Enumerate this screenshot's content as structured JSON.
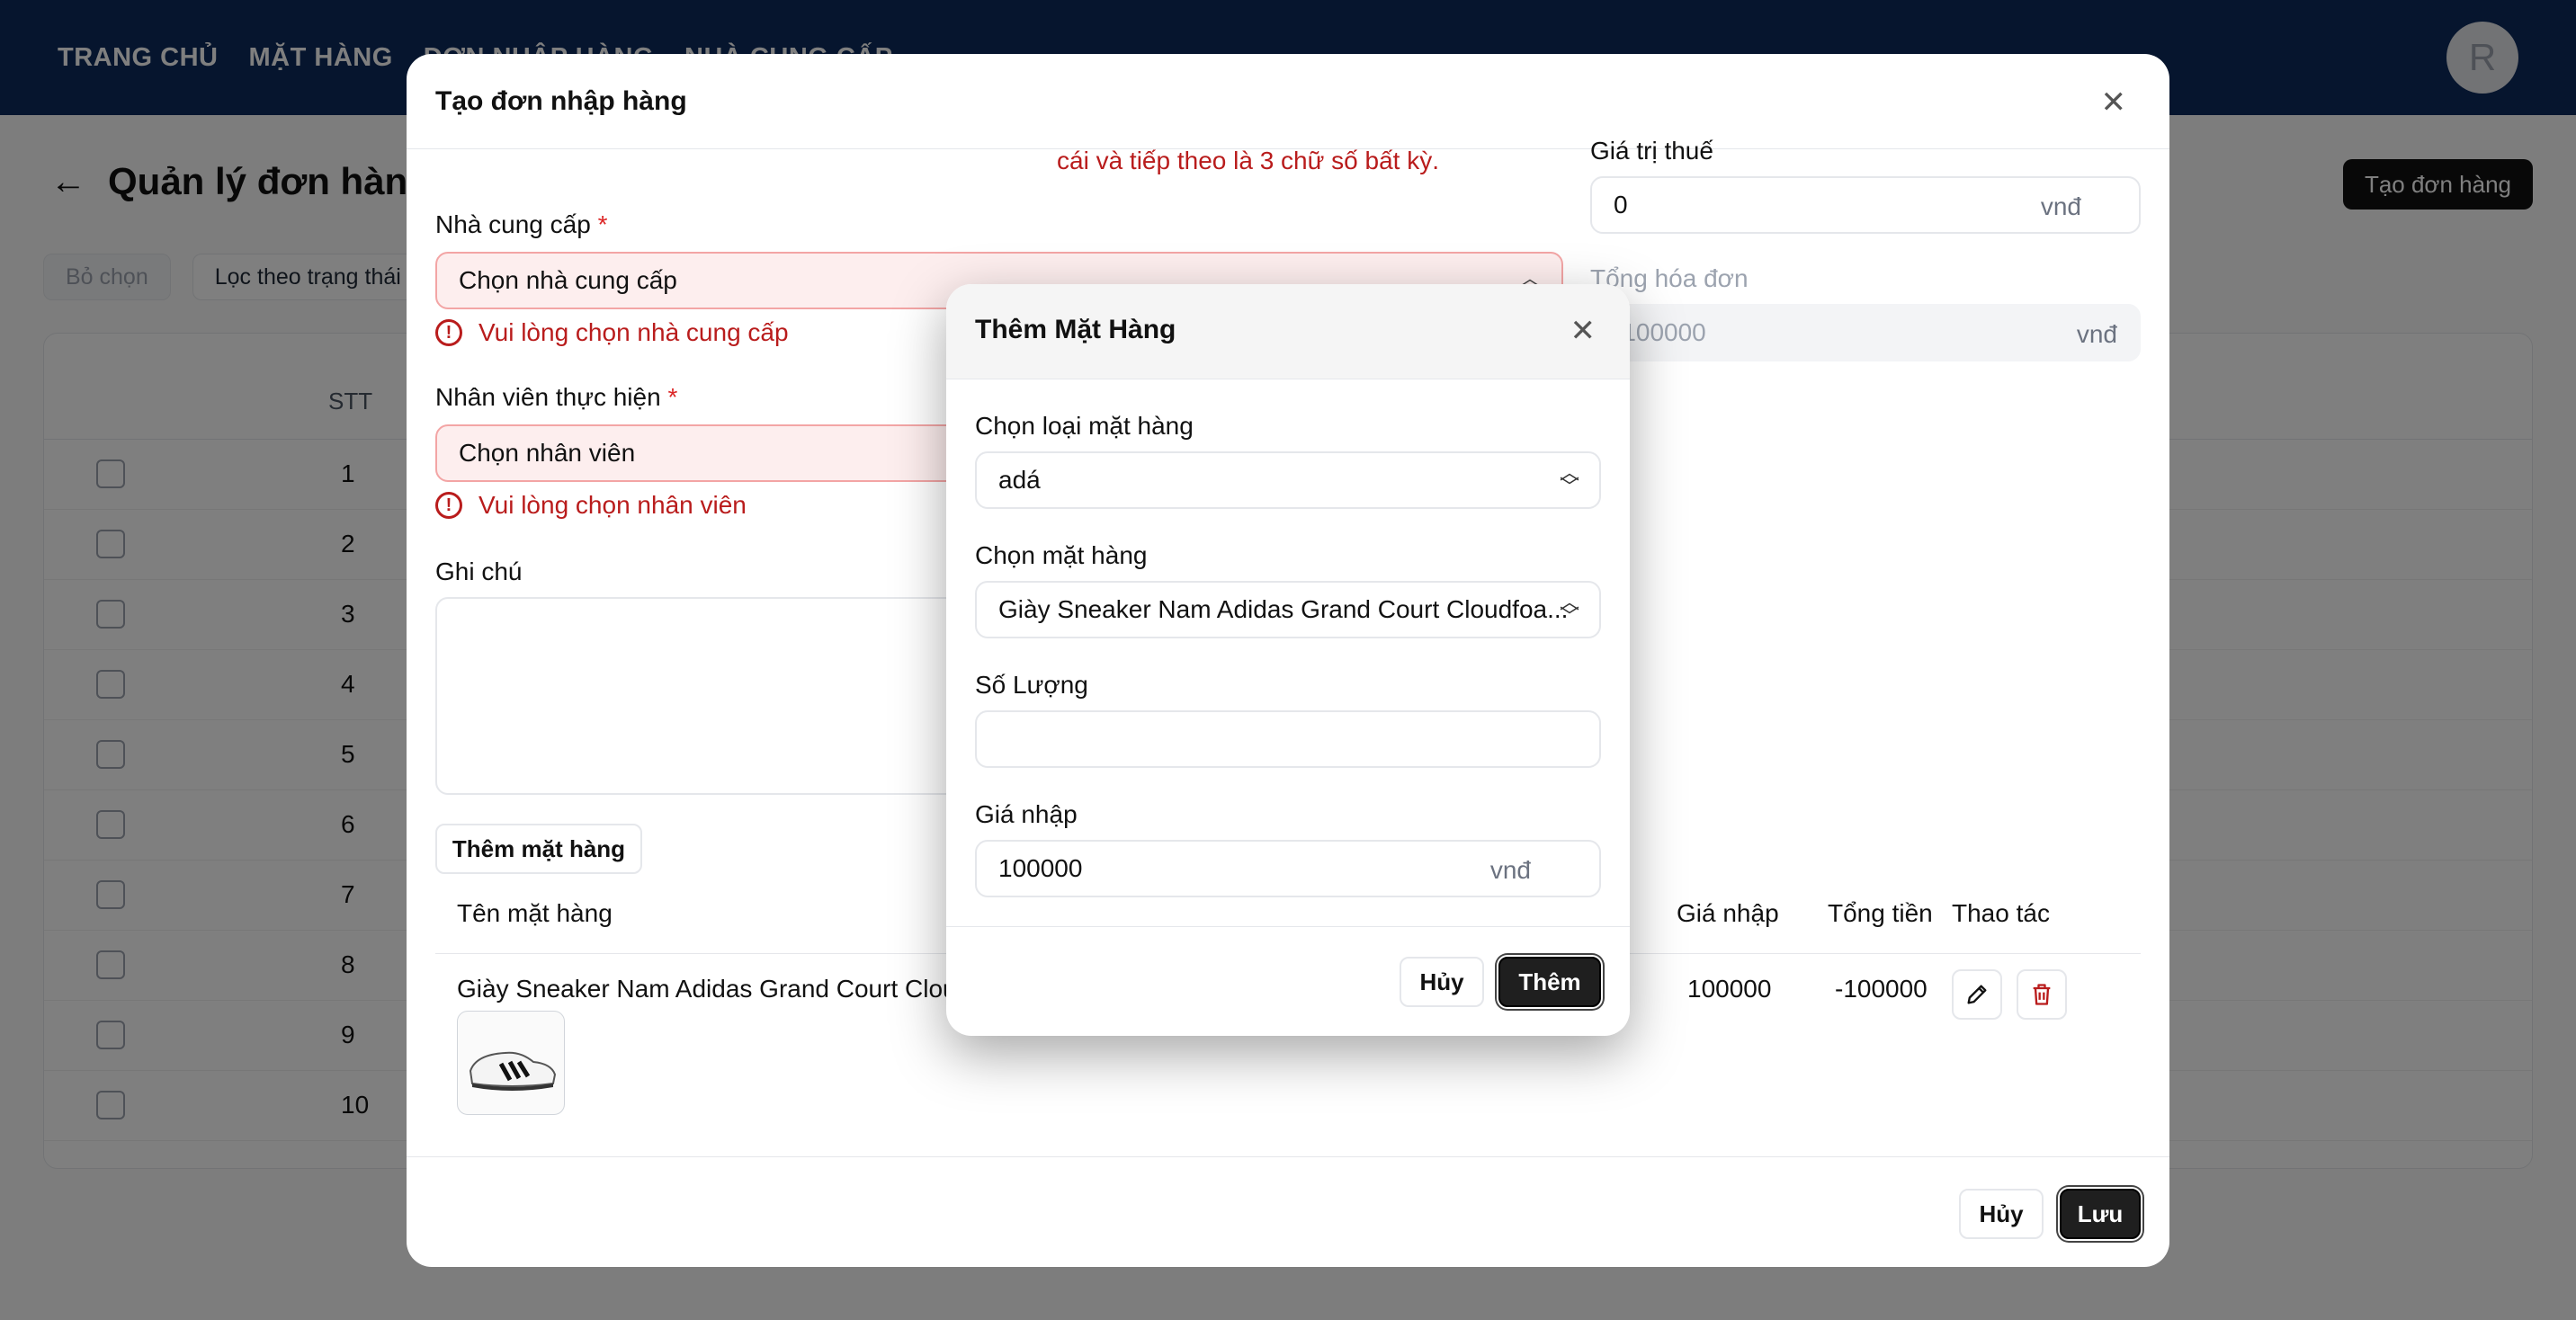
{
  "nav": {
    "items": [
      "TRANG CHỦ",
      "MẶT HÀNG",
      "ĐƠN NHẬP HÀNG",
      "NHÀ CUNG CẤP"
    ],
    "avatar_letter": "R"
  },
  "page": {
    "title": "Quản lý đơn hàng",
    "create_button": "Tạo đơn hàng",
    "filters": [
      "Bỏ chọn",
      "Lọc theo trạng thái"
    ],
    "table": {
      "stt_header": "STT",
      "rows": [
        "1",
        "2",
        "3",
        "4",
        "5",
        "6",
        "7",
        "8",
        "9",
        "10"
      ]
    }
  },
  "modal": {
    "title": "Tạo đơn nhập hàng",
    "top_error": "cái và tiếp theo là 3 chữ số bất kỳ.",
    "supplier": {
      "label": "Nhà cung cấp",
      "required": "*",
      "placeholder": "Chọn nhà cung cấp",
      "error": "Vui lòng chọn nhà cung cấp"
    },
    "employee": {
      "label": "Nhân viên thực hiện",
      "required": "*",
      "placeholder": "Chọn nhân viên",
      "error": "Vui lòng chọn nhân viên"
    },
    "note": {
      "label": "Ghi chú"
    },
    "tax": {
      "label": "Giá trị thuế",
      "value": "0",
      "unit": "vnđ"
    },
    "total": {
      "label": "Tổng hóa đơn",
      "value": "-100000",
      "unit": "vnđ"
    },
    "add_item_button": "Thêm mặt hàng",
    "items_table": {
      "headers": {
        "name": "Tên mặt hàng",
        "price": "Giá nhập",
        "total": "Tổng tiền",
        "actions": "Thao tác"
      },
      "rows": [
        {
          "name": "Giày Sneaker Nam Adidas Grand Court Cloudfoam",
          "price": "100000",
          "total": "-100000"
        }
      ]
    },
    "cancel_button": "Hủy",
    "save_button": "Lưu"
  },
  "add_item_modal": {
    "title": "Thêm Mặt Hàng",
    "category": {
      "label": "Chọn loại mặt hàng",
      "value": "adá"
    },
    "product": {
      "label": "Chọn mặt hàng",
      "value": "Giày Sneaker Nam Adidas Grand Court Cloudfoa..."
    },
    "quantity": {
      "label": "Số Lượng",
      "value": ""
    },
    "price": {
      "label": "Giá nhập",
      "value": "100000",
      "unit": "vnđ"
    },
    "cancel_button": "Hủy",
    "add_button": "Thêm"
  }
}
